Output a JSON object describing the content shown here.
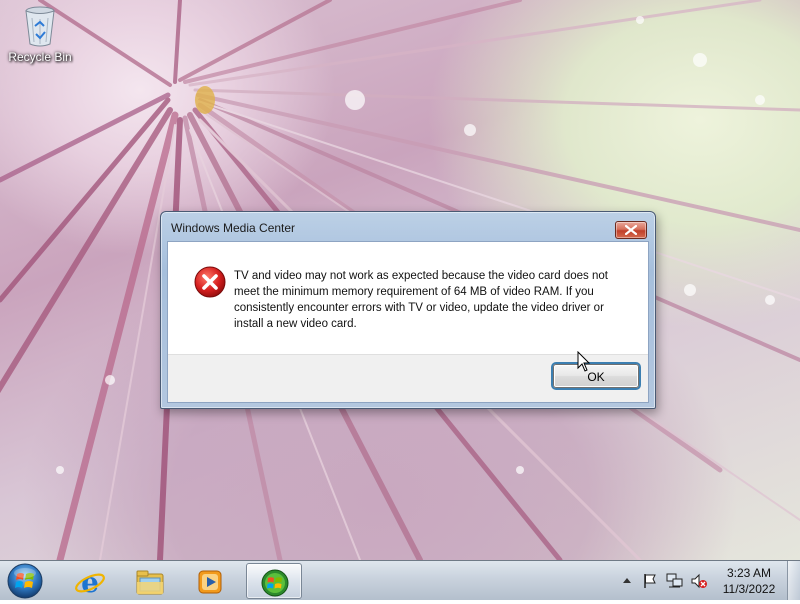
{
  "desktop": {
    "icons": [
      {
        "label": "Recycle Bin",
        "icon": "recycle-bin-icon"
      }
    ]
  },
  "dialog": {
    "title": "Windows Media Center",
    "icon": "error-icon",
    "message": "TV and video may not work as expected because the video card does not meet the minimum memory requirement of 64 MB of video RAM. If you consistently encounter errors with TV or video, update the video driver or install a new video card.",
    "ok_label": "OK",
    "close_icon": "close-icon"
  },
  "taskbar": {
    "start_icon": "windows-start-icon",
    "pinned": [
      {
        "name": "internet-explorer-icon"
      },
      {
        "name": "windows-explorer-icon"
      },
      {
        "name": "windows-media-player-icon"
      },
      {
        "name": "windows-media-center-icon",
        "active": true
      }
    ],
    "tray": {
      "icons": [
        "show-hidden-icons-icon",
        "action-center-flag-icon",
        "network-icon",
        "volume-muted-icon"
      ]
    },
    "clock": {
      "time": "3:23 AM",
      "date": "11/3/2022"
    }
  },
  "colors": {
    "close_button": "#c0402a",
    "error_red": "#d61f1f",
    "ok_focus": "#3c7fb1"
  }
}
